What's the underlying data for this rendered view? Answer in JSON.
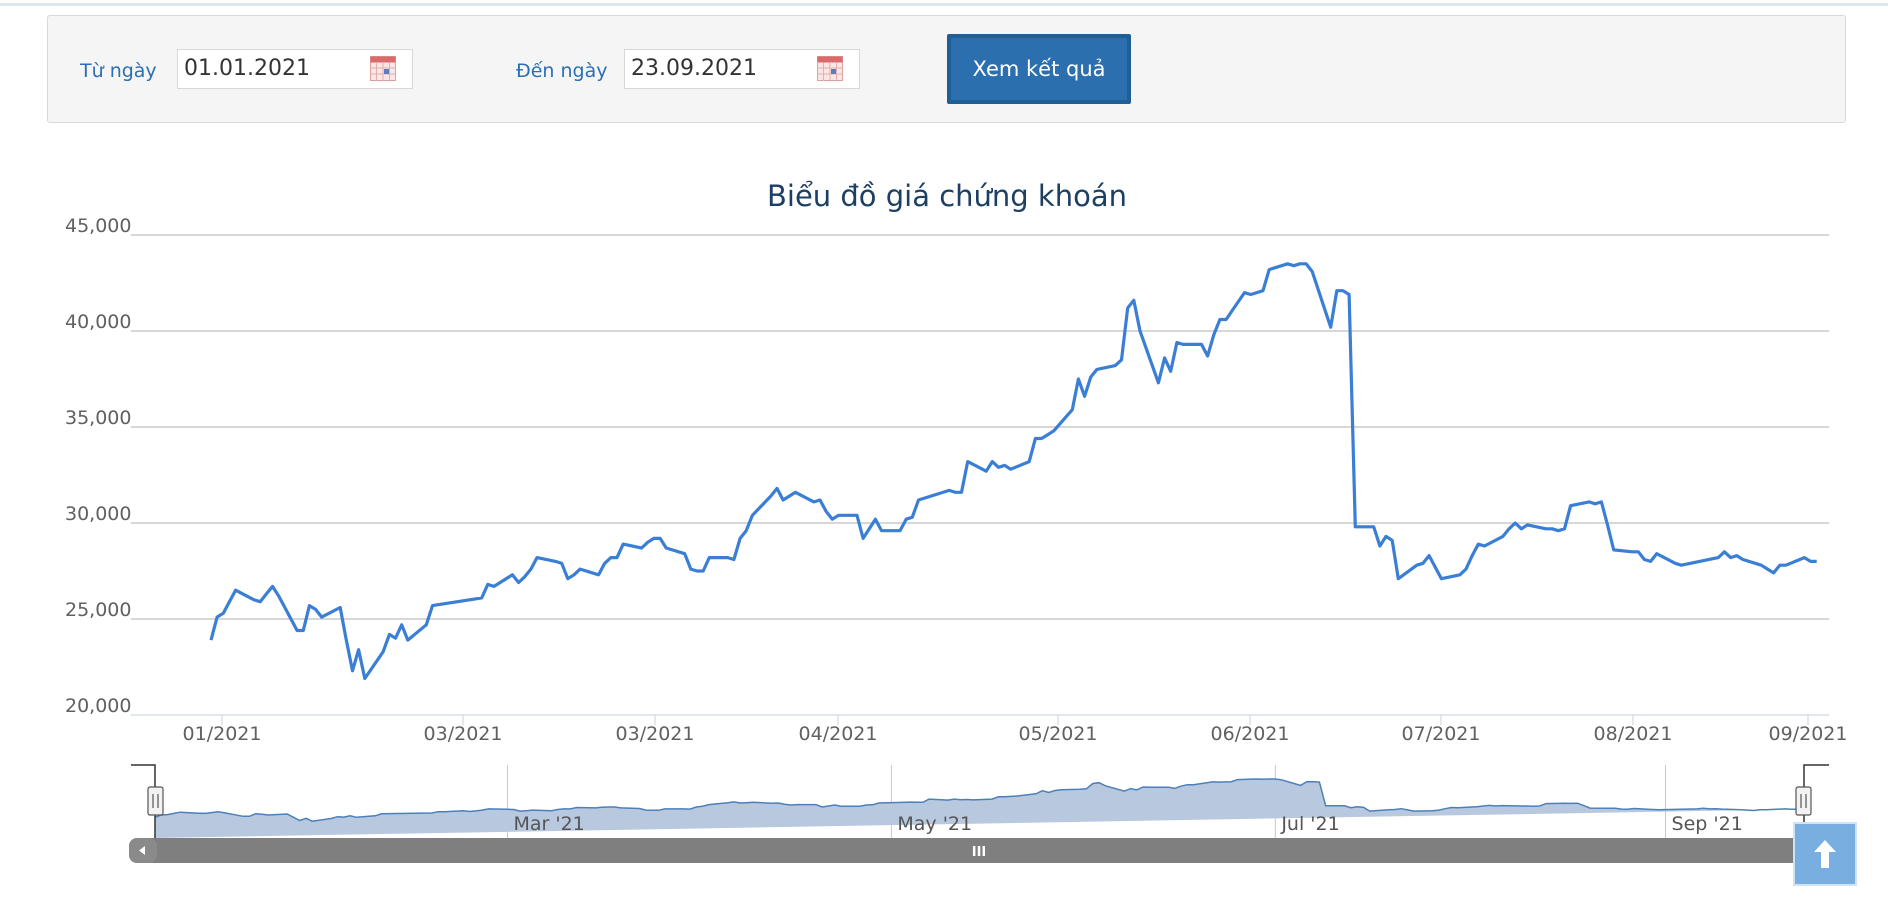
{
  "filter": {
    "from_label": "Từ ngày",
    "from_value": "01.01.2021",
    "to_label": "Đến ngày",
    "to_value": "23.09.2021",
    "submit_label": "Xem kết quả"
  },
  "colors": {
    "line": "#3a7fd5",
    "navigator_fill": "#b8c9df",
    "navigator_line": "#4d7fba",
    "accent": "#2b6fae"
  },
  "navigator": {
    "labels": [
      "Mar '21",
      "May '21",
      "Jul '21",
      "Sep '21"
    ],
    "scrollbar_grip": "III"
  },
  "chart_data": {
    "type": "line",
    "title": "Biểu đồ giá chứng khoán",
    "xlabel": "",
    "ylabel": "",
    "ylim": [
      20000,
      45000
    ],
    "yticks": [
      20000,
      25000,
      30000,
      35000,
      40000,
      45000
    ],
    "ytick_labels": [
      "20,000",
      "25,000",
      "30,000",
      "35,000",
      "40,000",
      "45,000"
    ],
    "xtick_labels": [
      "01/2021",
      "03/2021",
      "03/2021",
      "04/2021",
      "05/2021",
      "06/2021",
      "07/2021",
      "08/2021",
      "09/2021"
    ],
    "grid": true,
    "legend": "none",
    "x": [
      "2021-01-04",
      "2021-01-05",
      "2021-01-06",
      "2021-01-07",
      "2021-01-08",
      "2021-01-11",
      "2021-01-12",
      "2021-01-13",
      "2021-01-14",
      "2021-01-15",
      "2021-01-18",
      "2021-01-19",
      "2021-01-20",
      "2021-01-21",
      "2021-01-22",
      "2021-01-25",
      "2021-01-26",
      "2021-01-27",
      "2021-01-28",
      "2021-01-29",
      "2021-02-01",
      "2021-02-02",
      "2021-02-03",
      "2021-02-04",
      "2021-02-05",
      "2021-02-08",
      "2021-02-09",
      "2021-02-17",
      "2021-02-18",
      "2021-02-19",
      "2021-02-22",
      "2021-02-23",
      "2021-02-24",
      "2021-02-25",
      "2021-02-26",
      "2021-03-01",
      "2021-03-02",
      "2021-03-03",
      "2021-03-04",
      "2021-03-05",
      "2021-03-08",
      "2021-03-09",
      "2021-03-10",
      "2021-03-11",
      "2021-03-12",
      "2021-03-15",
      "2021-03-16",
      "2021-03-17",
      "2021-03-18",
      "2021-03-19",
      "2021-03-22",
      "2021-03-23",
      "2021-03-24",
      "2021-03-25",
      "2021-03-26",
      "2021-03-29",
      "2021-03-30",
      "2021-03-31",
      "2021-04-01",
      "2021-04-02",
      "2021-04-05",
      "2021-04-06",
      "2021-04-07",
      "2021-04-08",
      "2021-04-09",
      "2021-04-12",
      "2021-04-13",
      "2021-04-14",
      "2021-04-15",
      "2021-04-16",
      "2021-04-19",
      "2021-04-20",
      "2021-04-22",
      "2021-04-23",
      "2021-04-26",
      "2021-04-27",
      "2021-04-28",
      "2021-04-29",
      "2021-05-04",
      "2021-05-05",
      "2021-05-06",
      "2021-05-07",
      "2021-05-10",
      "2021-05-11",
      "2021-05-12",
      "2021-05-13",
      "2021-05-14",
      "2021-05-17",
      "2021-05-18",
      "2021-05-19",
      "2021-05-20",
      "2021-05-21",
      "2021-05-24",
      "2021-05-25",
      "2021-05-26",
      "2021-05-27",
      "2021-05-28",
      "2021-05-31",
      "2021-06-01",
      "2021-06-02",
      "2021-06-03",
      "2021-06-04",
      "2021-06-07",
      "2021-06-08",
      "2021-06-09",
      "2021-06-10",
      "2021-06-11",
      "2021-06-14",
      "2021-06-15",
      "2021-06-16",
      "2021-06-17",
      "2021-06-18",
      "2021-06-21",
      "2021-06-22",
      "2021-06-23",
      "2021-06-24",
      "2021-06-25",
      "2021-06-28",
      "2021-06-29",
      "2021-06-30",
      "2021-07-01",
      "2021-07-02",
      "2021-07-05",
      "2021-07-06",
      "2021-07-07",
      "2021-07-08",
      "2021-07-09",
      "2021-07-12",
      "2021-07-13",
      "2021-07-14",
      "2021-07-15",
      "2021-07-16",
      "2021-07-19",
      "2021-07-20",
      "2021-07-21",
      "2021-07-22",
      "2021-07-23",
      "2021-07-26",
      "2021-07-27",
      "2021-07-28",
      "2021-07-29",
      "2021-07-30",
      "2021-08-02",
      "2021-08-03",
      "2021-08-04",
      "2021-08-05",
      "2021-08-06",
      "2021-08-09",
      "2021-08-10",
      "2021-08-11",
      "2021-08-12",
      "2021-08-13",
      "2021-08-16",
      "2021-08-17",
      "2021-08-18",
      "2021-08-19",
      "2021-08-20",
      "2021-08-23",
      "2021-08-24",
      "2021-08-25",
      "2021-08-26",
      "2021-08-27",
      "2021-08-30",
      "2021-08-31",
      "2021-09-06",
      "2021-09-07",
      "2021-09-08",
      "2021-09-09",
      "2021-09-10",
      "2021-09-13",
      "2021-09-14",
      "2021-09-15",
      "2021-09-16",
      "2021-09-17",
      "2021-09-20",
      "2021-09-21",
      "2021-09-22",
      "2021-09-23"
    ],
    "series": [
      {
        "values": [
          23900,
          25100,
          25300,
          25900,
          26500,
          26000,
          25900,
          26300,
          26700,
          26200,
          24400,
          24400,
          25700,
          25500,
          25100,
          25600,
          23900,
          22300,
          23400,
          21900,
          23300,
          24200,
          24000,
          24700,
          23900,
          24700,
          25700,
          26100,
          26800,
          26700,
          27300,
          26900,
          27200,
          27600,
          28200,
          28000,
          27900,
          27100,
          27300,
          27600,
          27300,
          27900,
          28200,
          28200,
          28900,
          28700,
          29000,
          29200,
          29200,
          28700,
          28400,
          27600,
          27500,
          27500,
          28200,
          28200,
          28100,
          29200,
          29600,
          30400,
          31400,
          31800,
          31200,
          31400,
          31600,
          31100,
          31200,
          30600,
          30200,
          30400,
          30400,
          29200,
          30200,
          29600,
          29600,
          30200,
          30300,
          31200,
          31700,
          31600,
          31600,
          33200,
          32700,
          33200,
          32900,
          33000,
          32800,
          33200,
          34400,
          34400,
          34600,
          34800,
          35900,
          37500,
          36600,
          37600,
          38000,
          38200,
          38500,
          41200,
          41600,
          40000,
          37300,
          38600,
          37900,
          39400,
          39300,
          39300,
          38700,
          39800,
          40600,
          40600,
          42000,
          41900,
          42000,
          42100,
          43200,
          43500,
          43400,
          43500,
          43500,
          43100,
          40200,
          42100,
          42100,
          41900,
          29800,
          29800,
          28800,
          29300,
          29100,
          27100,
          27800,
          27900,
          28300,
          27700,
          27100,
          27300,
          27600,
          28300,
          28900,
          28800,
          29300,
          29700,
          30000,
          29700,
          29900,
          29700,
          29700,
          29600,
          29700,
          30900,
          31100,
          31000,
          31100,
          29900,
          28600,
          28500,
          28500,
          28100,
          28000,
          28400,
          27900,
          27800,
          28200,
          28500,
          28200,
          28300,
          28100,
          27800,
          27600,
          27400,
          27800,
          27800,
          28200,
          28000,
          28000
        ],
        "color": "#3a7fd5"
      }
    ]
  }
}
